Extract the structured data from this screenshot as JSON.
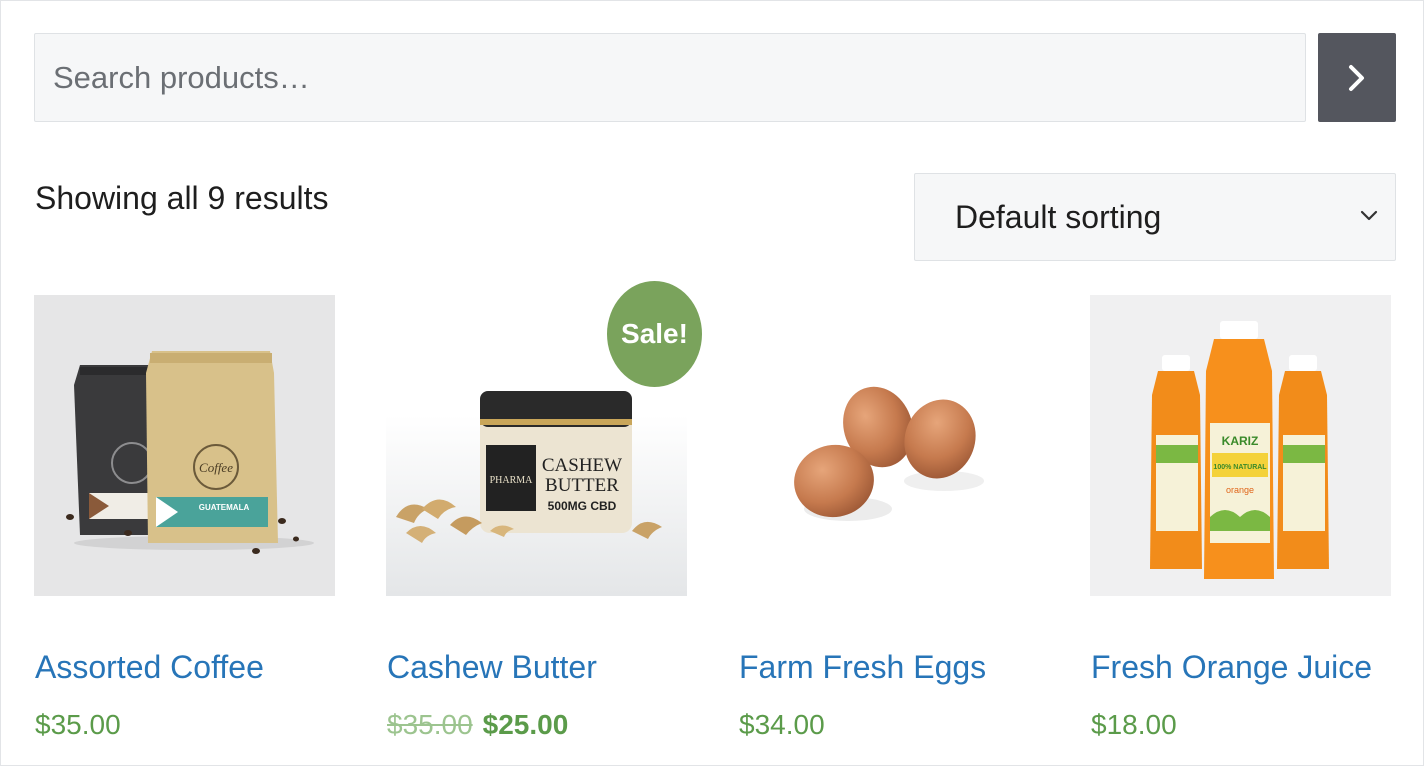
{
  "search": {
    "placeholder": "Search products…",
    "submit_icon": "chevron-right-icon"
  },
  "result_count": "Showing all 9 results",
  "sorting": {
    "selected": "Default sorting",
    "icon": "chevron-down-icon"
  },
  "products": [
    {
      "name": "Assorted Coffee",
      "price": "$35.00"
    },
    {
      "name": "Cashew Butter",
      "regular_price": "$35.00",
      "sale_price": "$25.00",
      "badge": "Sale!"
    },
    {
      "name": "Farm Fresh Eggs",
      "price": "$34.00"
    },
    {
      "name": "Fresh Orange Juice",
      "price": "$18.00"
    }
  ],
  "product_images": {
    "coffee": {
      "bag_text": "Coffee",
      "label_text": "GUATEMALA"
    },
    "cashew": {
      "lid_text": "PHARMA",
      "title_line1": "CASHEW",
      "title_line2": "BUTTER",
      "strength": "500MG CBD"
    },
    "juice": {
      "brand": "KARIZ",
      "claim": "100% NATURAL",
      "flavor": "orange"
    }
  },
  "colors": {
    "link": "#2775b8",
    "price": "#5b9b4a",
    "sale_badge": "#7aa35c",
    "search_button": "#54565e"
  }
}
